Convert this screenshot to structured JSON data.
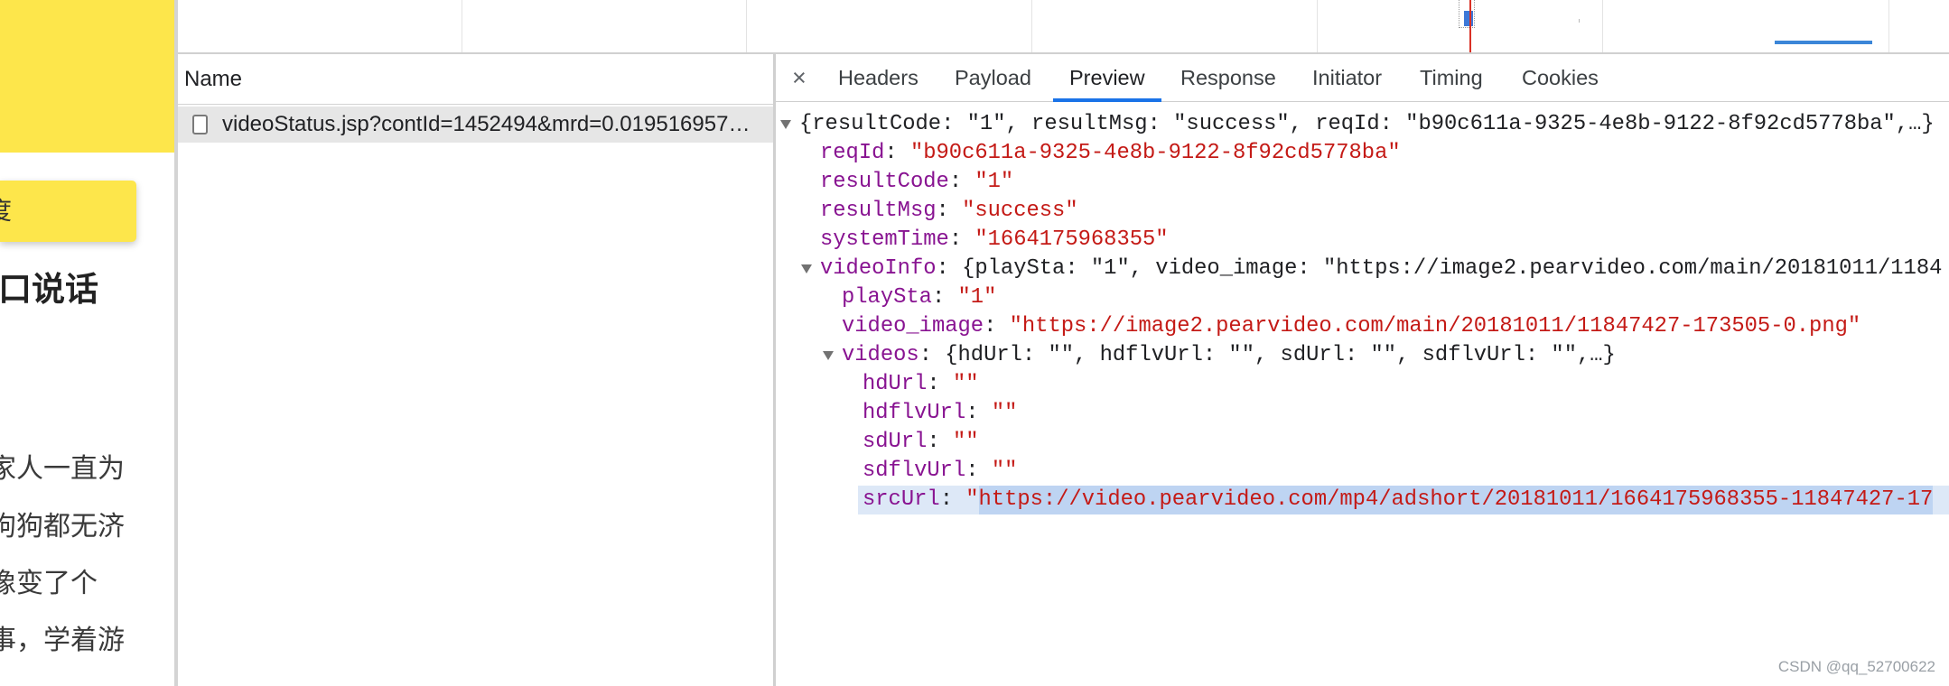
{
  "page": {
    "button_label": "度",
    "heading": "口说话",
    "paragraph_lines": [
      "家人一直为",
      "狗狗都无济",
      "像变了个",
      "事，学着游"
    ]
  },
  "devtools": {
    "requests_panel": {
      "column_header": "Name",
      "requests": [
        {
          "name": "videoStatus.jsp?contId=1452494&mrd=0.019516957…",
          "selected": true,
          "icon": "document-icon"
        }
      ]
    },
    "details": {
      "close_label": "×",
      "tabs": [
        {
          "label": "Headers"
        },
        {
          "label": "Payload"
        },
        {
          "label": "Preview",
          "active": true
        },
        {
          "label": "Response"
        },
        {
          "label": "Initiator"
        },
        {
          "label": "Timing"
        },
        {
          "label": "Cookies"
        }
      ],
      "preview": {
        "separator": ": ",
        "root": {
          "summary": "{resultCode: \"1\", resultMsg: \"success\", reqId: \"b90c611a-9325-4e8b-9122-8f92cd5778ba\",…}",
          "expanded": true,
          "fields": [
            {
              "key": "reqId",
              "value": "\"b90c611a-9325-4e8b-9122-8f92cd5778ba\""
            },
            {
              "key": "resultCode",
              "value": "\"1\""
            },
            {
              "key": "resultMsg",
              "value": "\"success\""
            },
            {
              "key": "systemTime",
              "value": "\"1664175968355\""
            },
            {
              "key": "videoInfo",
              "summary": "{playSta: \"1\", video_image: \"https://image2.pearvideo.com/main/20181011/1184",
              "expanded": true,
              "fields": [
                {
                  "key": "playSta",
                  "value": "\"1\""
                },
                {
                  "key": "video_image",
                  "value": "\"https://image2.pearvideo.com/main/20181011/11847427-173505-0.png\""
                },
                {
                  "key": "videos",
                  "summary": "{hdUrl: \"\", hdflvUrl: \"\", sdUrl: \"\", sdflvUrl: \"\",…}",
                  "expanded": true,
                  "fields": [
                    {
                      "key": "hdUrl",
                      "value": "\"\""
                    },
                    {
                      "key": "hdflvUrl",
                      "value": "\"\""
                    },
                    {
                      "key": "sdUrl",
                      "value": "\"\""
                    },
                    {
                      "key": "sdflvUrl",
                      "value": "\"\""
                    },
                    {
                      "key": "srcUrl",
                      "value_quote": "\"",
                      "value_selected": "https://video.pearvideo.com/mp4/adshort/20181011/1664175968355-11847427-17",
                      "selected": true
                    }
                  ]
                }
              ]
            }
          ]
        }
      }
    }
  },
  "watermark": "CSDN @qq_52700622",
  "colors": {
    "banner": "#fde64b",
    "accent": "#1a73e8",
    "json_key": "#881391",
    "json_string": "#c41a16",
    "selection": "#bed4f2",
    "timeline_marker": "#d93025"
  }
}
